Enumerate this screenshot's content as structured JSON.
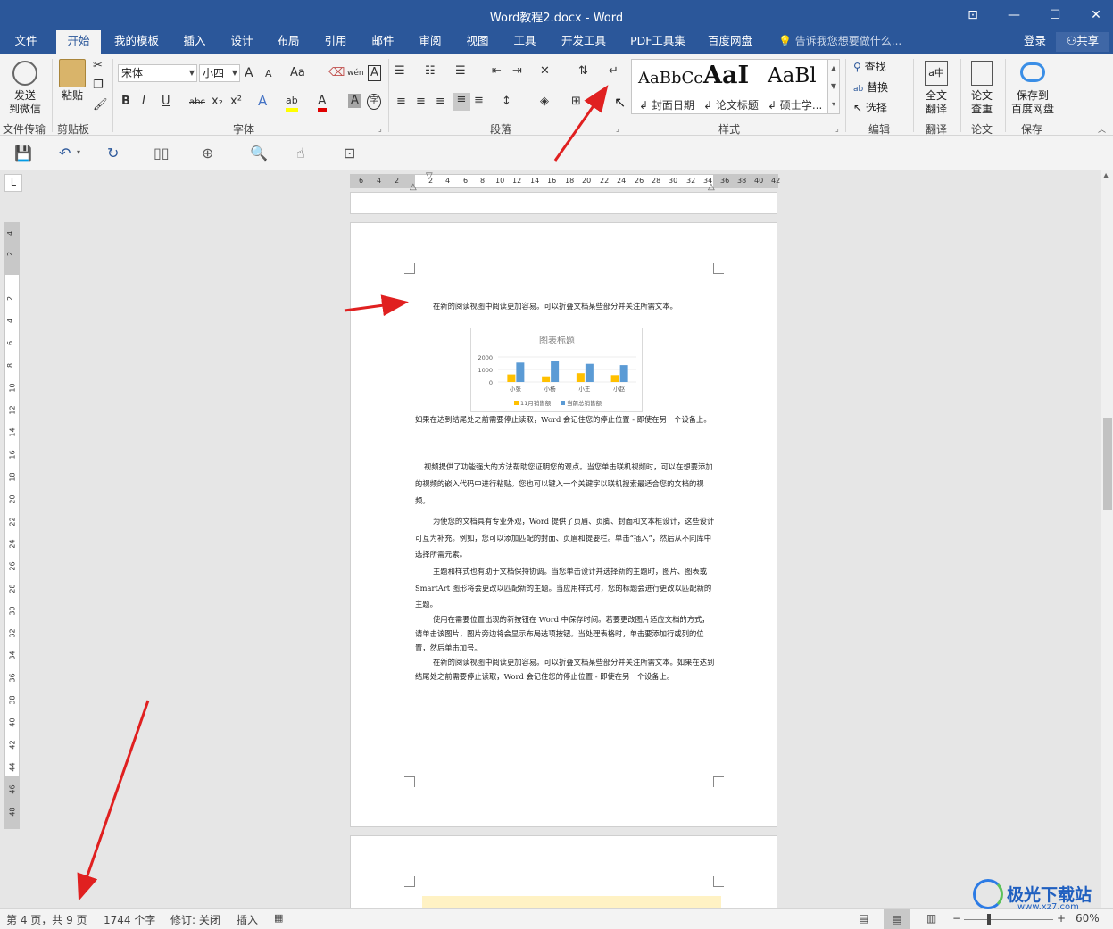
{
  "window": {
    "title": "Word教程2.docx - Word",
    "btn_ribbon": "⊡",
    "btn_minimize": "—",
    "btn_maximize": "☐",
    "btn_close": "✕"
  },
  "tabs": [
    "文件",
    "开始",
    "我的模板",
    "插入",
    "设计",
    "布局",
    "引用",
    "邮件",
    "审阅",
    "视图",
    "工具",
    "开发工具",
    "PDF工具集",
    "百度网盘"
  ],
  "active_tab": "开始",
  "tell_me": "告诉我您想要做什么...",
  "account": {
    "login": "登录",
    "share": "共享"
  },
  "ribbon": {
    "send_wechat": "发送\n到微信",
    "group_file_transfer": "文件传输",
    "paste": "粘贴",
    "group_clipboard": "剪贴板",
    "font_name": "宋体",
    "font_size": "小四",
    "group_font": "字体",
    "group_paragraph": "段落",
    "styles": [
      {
        "preview": "AaBbCc",
        "name": "↲ 封面日期"
      },
      {
        "preview": "AaI",
        "name": "↲ 论文标题"
      },
      {
        "preview": "AaBl",
        "name": "↲ 硕士学..."
      }
    ],
    "group_styles": "样式",
    "find": "查找",
    "replace": "替换",
    "select": "选择",
    "group_editing": "编辑",
    "full_translate": "全文\n翻译",
    "group_translate": "翻译",
    "paper_check": "论文\n查重",
    "group_paper": "论文",
    "save_baidu": "保存到\n百度网盘",
    "group_save": "保存",
    "font_buttons": [
      "B",
      "I",
      "U",
      "abc",
      "x₂",
      "x²",
      "A",
      "A",
      "A",
      "A",
      "字"
    ],
    "size_buttons": [
      "A",
      "A",
      "Aa",
      "wén"
    ]
  },
  "ruler": {
    "h_numbers": [
      "6",
      "4",
      "2",
      "2",
      "4",
      "6",
      "8",
      "10",
      "12",
      "14",
      "16",
      "18",
      "20",
      "22",
      "24",
      "26",
      "28",
      "30",
      "32",
      "34",
      "36",
      "38",
      "40",
      "42"
    ],
    "v_numbers": [
      "4",
      "2",
      "2",
      "4",
      "6",
      "8",
      "10",
      "12",
      "14",
      "16",
      "18",
      "20",
      "22",
      "24",
      "26",
      "28",
      "30",
      "32",
      "34",
      "36",
      "38",
      "40",
      "42",
      "44",
      "46",
      "48"
    ],
    "tab_selector": "L"
  },
  "document": {
    "p1": "在新的阅读视图中阅读更加容易。可以折叠文档某些部分并关注所需文本。",
    "p2": "如果在达到结尾处之前需要停止读取，Word 会记住您的停止位置 - 即使在另一个设备上。",
    "p3": "视频提供了功能强大的方法帮助您证明您的观点。当您单击联机视频时，可以在想要添加的视频的嵌入代码中进行粘贴。您也可以键入一个关键字以联机搜索最适合您的文档的视频。",
    "p4": "为使您的文档具有专业外观，Word 提供了页眉、页脚、封面和文本框设计，这些设计可互为补充。例如，您可以添加匹配的封面、页眉和提要栏。单击“插入”，然后从不同库中选择所需元素。",
    "p5": "主题和样式也有助于文档保持协调。当您单击设计并选择新的主题时，图片、图表或 SmartArt 图形将会更改以匹配新的主题。当应用样式时，您的标题会进行更改以匹配新的主题。",
    "p6": "使用在需要位置出现的新按钮在 Word 中保存时间。若要更改图片适应文档的方式，请单击该图片，图片旁边将会显示布局选项按钮。当处理表格时，单击要添加行或列的位置，然后单击加号。",
    "p7": "在新的阅读视图中阅读更加容易。可以折叠文档某些部分并关注所需文本。如果在达到结尾处之前需要停止读取，Word 会记住您的停止位置 - 即使在另一个设备上。"
  },
  "chart_data": {
    "type": "bar",
    "title": "图表标题",
    "categories": [
      "小张",
      "小杨",
      "小王",
      "小赵"
    ],
    "series": [
      {
        "name": "11月销售额",
        "values": [
          600,
          450,
          700,
          550
        ],
        "color": "#ffc000"
      },
      {
        "name": "当前总销售额",
        "values": [
          1550,
          1700,
          1450,
          1350
        ],
        "color": "#5b9bd5"
      }
    ],
    "ylim": [
      0,
      2000
    ],
    "yticks": [
      "2000",
      "1000",
      "0"
    ],
    "legend": "bottom",
    "grid": true
  },
  "status": {
    "page": "第 4 页，共 9 页",
    "words": "1744 个字",
    "track": "修订: 关闭",
    "mode": "插入",
    "zoom": "60%",
    "zoom_minus": "−",
    "zoom_plus": "+"
  },
  "watermark": {
    "text": "极光下载站",
    "url": "www.xz7.com"
  },
  "colors": {
    "title_bar": "#2b579a",
    "ribbon": "#f3f3f3",
    "annotation": "#e02020"
  }
}
